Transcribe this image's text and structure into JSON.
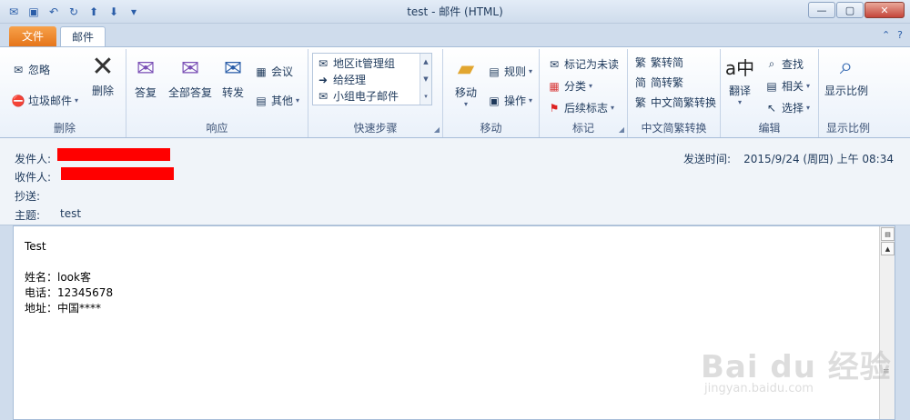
{
  "window": {
    "title": "test - 邮件 (HTML)"
  },
  "qat": {
    "icons": [
      "mail-icon",
      "save-icon",
      "undo-icon",
      "redo-icon",
      "up-arrow-icon",
      "down-arrow-icon",
      "customize-icon"
    ]
  },
  "tabs": {
    "file": "文件",
    "mail": "邮件"
  },
  "ribbon": {
    "delete": {
      "label": "删除",
      "ignore": "忽略",
      "junk": "垃圾邮件",
      "delete_btn": "删除"
    },
    "respond": {
      "label": "响应",
      "reply": "答复",
      "reply_all": "全部答复",
      "forward": "转发",
      "meeting": "会议",
      "more": "其他"
    },
    "quicksteps": {
      "label": "快速步骤",
      "items": [
        "地区it管理组",
        "给经理",
        "小组电子邮件"
      ]
    },
    "move": {
      "label": "移动",
      "move_btn": "移动",
      "rules": "规则",
      "actions": "操作"
    },
    "tags": {
      "label": "标记",
      "mark_unread": "标记为未读",
      "categorize": "分类",
      "follow_up": "后续标志"
    },
    "chinese": {
      "label": "中文简繁转换",
      "to_simplified": "繁转简",
      "to_traditional": "简转繁",
      "convert": "中文简繁转换"
    },
    "editing": {
      "label": "编辑",
      "translate": "翻译",
      "find": "查找",
      "related": "相关",
      "select": "选择"
    },
    "zoom": {
      "label": "显示比例",
      "zoom_btn": "显示比例"
    }
  },
  "header": {
    "from_label": "发件人:",
    "to_label": "收件人:",
    "cc_label": "抄送:",
    "subject_label": "主题:",
    "subject_value": "test",
    "sent_label": "发送时间:",
    "sent_value": "2015/9/24 (周四) 上午 08:34"
  },
  "body": {
    "lines": [
      "Test",
      "",
      "姓名：look客",
      "电话：12345678",
      "地址：中国****"
    ]
  },
  "watermark": {
    "main": "Bai du 经验",
    "sub": "jingyan.baidu.com"
  },
  "colors": {
    "file_tab": "#e5751a",
    "redaction": "#ff0000",
    "accent": "#2a5da8"
  }
}
